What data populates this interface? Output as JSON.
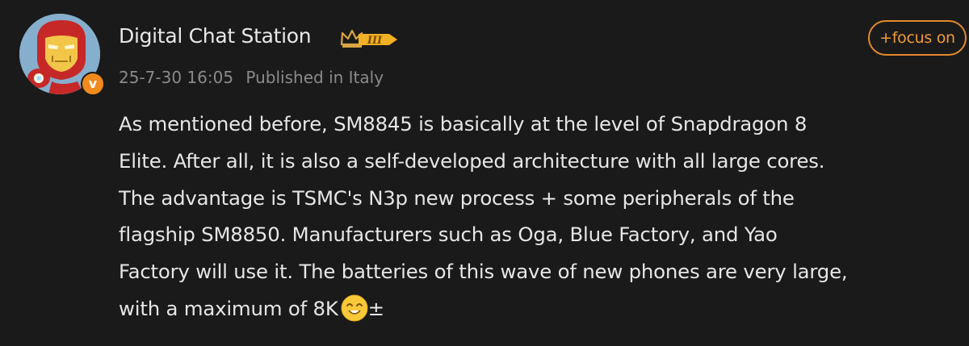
{
  "post": {
    "author": "Digital Chat Station",
    "rank_badge": "III",
    "verified_mark": "v",
    "timestamp": "25-7-30 16:05",
    "location": "Published in Italy",
    "follow_label": "+focus on",
    "lines": [
      "As mentioned before, SM8845 is basically at the level of Snapdragon 8",
      "Elite. After all, it is also a self-developed architecture with all large cores.",
      "The advantage is TSMC's N3p new process + some peripherals of the",
      "flagship SM8850. Manufacturers such as Oga, Blue Factory, and Yao",
      "Factory will use it. The batteries of this wave of new phones are very large,",
      "with a maximum of 8K"
    ],
    "trailing_symbol": "±",
    "icons": {
      "avatar": "iron-man-avatar",
      "rank": "crown-rank-icon",
      "emoji": "smiling-face-emoji"
    },
    "colors": {
      "background": "#1a1a1a",
      "accent": "#e28a2c",
      "badge": "#f08a1c",
      "text": "#e6e6e6",
      "muted": "#8a8a8a"
    }
  }
}
